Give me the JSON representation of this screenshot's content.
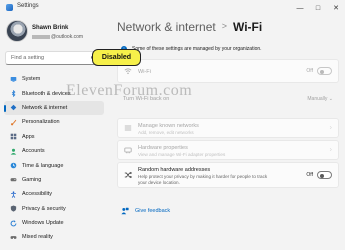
{
  "window": {
    "title": "Settings"
  },
  "user": {
    "name": "Shawn Brink",
    "email_suffix": "@outlook.com"
  },
  "search": {
    "placeholder": "Find a setting"
  },
  "sidebar": {
    "items": [
      {
        "label": "System",
        "icon": "monitor-icon",
        "color": "#3b8de0"
      },
      {
        "label": "Bluetooth & devices",
        "icon": "bluetooth-icon",
        "color": "#2a7fd4"
      },
      {
        "label": "Network & internet",
        "icon": "wifi-diamond-icon",
        "color": "#1f6fc5",
        "active": true
      },
      {
        "label": "Personalization",
        "icon": "brush-icon",
        "color": "#e07a2e"
      },
      {
        "label": "Apps",
        "icon": "apps-icon",
        "color": "#5b6b86"
      },
      {
        "label": "Accounts",
        "icon": "person-icon",
        "color": "#2fa86b"
      },
      {
        "label": "Time & language",
        "icon": "globe-clock-icon",
        "color": "#2b88d8"
      },
      {
        "label": "Gaming",
        "icon": "controller-icon",
        "color": "#6f6f6f"
      },
      {
        "label": "Accessibility",
        "icon": "accessibility-icon",
        "color": "#2266cc"
      },
      {
        "label": "Privacy & security",
        "icon": "shield-icon",
        "color": "#5a6472"
      },
      {
        "label": "Windows Update",
        "icon": "update-icon",
        "color": "#1f78d1"
      },
      {
        "label": "Mixed reality",
        "icon": "headset-icon",
        "color": "#6a6a6a"
      }
    ]
  },
  "breadcrumb": {
    "parent": "Network & internet",
    "separator": ">",
    "current": "Wi-Fi"
  },
  "info": {
    "text": "Some of these settings are managed by your organization."
  },
  "wifi": {
    "label": "Wi-Fi",
    "state": "Off"
  },
  "badge": {
    "text": "Disabled"
  },
  "turn_on": {
    "label": "Turn Wi-Fi back on",
    "value": "Manually"
  },
  "manage_networks": {
    "title": "Manage known networks",
    "subtitle": "Add, remove, edit networks"
  },
  "hardware": {
    "title": "Hardware properties",
    "subtitle": "View and manage Wi-Fi adapter properties"
  },
  "random_mac": {
    "title": "Random hardware addresses",
    "subtitle_line1": "Help protect your privacy by making it harder for people to track",
    "subtitle_line2": "your device location.",
    "state": "Off"
  },
  "feedback": {
    "label": "Give feedback"
  },
  "watermark": {
    "text": "ElevenForum.com"
  },
  "colors": {
    "accent": "#0067c0",
    "badge_bg": "#f6f04a"
  }
}
